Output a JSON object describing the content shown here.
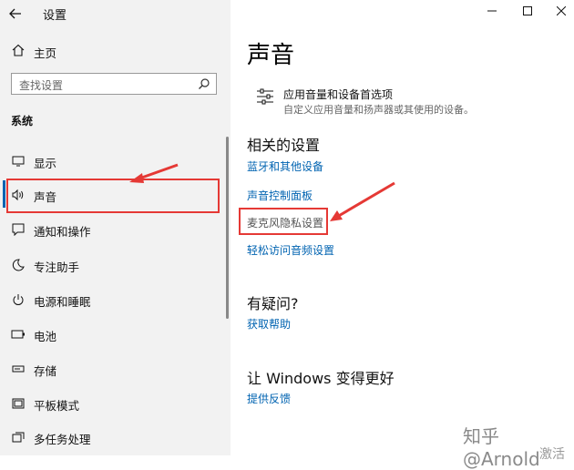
{
  "window": {
    "title": "设置",
    "back_icon": "back-arrow-icon",
    "controls": [
      "minimize-icon",
      "maximize-icon",
      "close-icon"
    ]
  },
  "sidebar": {
    "home_label": "主页",
    "search_placeholder": "查找设置",
    "section_label": "系统",
    "items": [
      {
        "label": "显示",
        "icon": "display-icon"
      },
      {
        "label": "声音",
        "icon": "speaker-icon",
        "selected": true
      },
      {
        "label": "通知和操作",
        "icon": "notification-icon"
      },
      {
        "label": "专注助手",
        "icon": "moon-icon"
      },
      {
        "label": "电源和睡眠",
        "icon": "power-icon"
      },
      {
        "label": "电池",
        "icon": "battery-icon"
      },
      {
        "label": "存储",
        "icon": "storage-icon"
      },
      {
        "label": "平板模式",
        "icon": "tablet-icon"
      },
      {
        "label": "多任务处理",
        "icon": "multitask-icon"
      }
    ]
  },
  "main": {
    "page_title": "声音",
    "app_volume": {
      "title": "应用音量和设备首选项",
      "subtitle": "自定义应用音量和扬声器或其使用的设备。"
    },
    "related": {
      "heading": "相关的设置",
      "links": [
        "蓝牙和其他设备",
        "声音控制面板",
        "麦克风隐私设置",
        "轻松访问音频设置"
      ]
    },
    "help": {
      "heading": "有疑问?",
      "link": "获取帮助"
    },
    "improve": {
      "heading": "让 Windows 变得更好",
      "link": "提供反馈"
    }
  },
  "colors": {
    "accent": "#0063b1",
    "annotation": "#e53935"
  },
  "watermark": "知乎 @Arnold",
  "watermark_cut": "激活"
}
